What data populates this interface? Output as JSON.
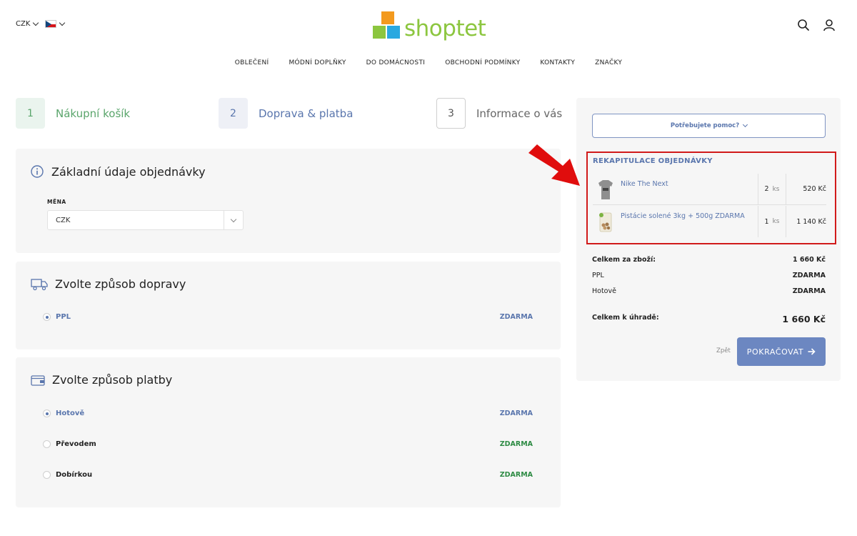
{
  "header": {
    "currency": "CZK",
    "logo_text": "shoptet",
    "nav": [
      "OBLEČENÍ",
      "MÓDNÍ DOPLŇKY",
      "DO DOMÁCNOSTI",
      "OBCHODNÍ PODMÍNKY",
      "KONTAKTY",
      "ZNAČKY"
    ],
    "icons": [
      "search-icon",
      "user-icon"
    ]
  },
  "steps": [
    {
      "num": "1",
      "label": "Nákupní košík"
    },
    {
      "num": "2",
      "label": "Doprava & platba"
    },
    {
      "num": "3",
      "label": "Informace o vás"
    }
  ],
  "order_basics": {
    "title": "Základní údaje objednávky",
    "currency_label": "MĚNA",
    "currency_value": "CZK"
  },
  "shipping": {
    "title": "Zvolte způsob dopravy",
    "options": [
      {
        "label": "PPL",
        "price": "ZDARMA",
        "selected": true
      }
    ]
  },
  "payment": {
    "title": "Zvolte způsob platby",
    "options": [
      {
        "label": "Hotově",
        "price": "ZDARMA",
        "selected": true
      },
      {
        "label": "Převodem",
        "price": "ZDARMA",
        "selected": false
      },
      {
        "label": "Dobírkou",
        "price": "ZDARMA",
        "selected": false
      }
    ]
  },
  "sidebar": {
    "help_label": "Potřebujete pomoc?",
    "recap_title": "REKAPITULACE OBJEDNÁVKY",
    "items": [
      {
        "name": "Nike The Next",
        "qty": "2",
        "unit": "ks",
        "price": "520 Kč"
      },
      {
        "name": "Pistácie solené 3kg + 500g ZDARMA",
        "qty": "1",
        "unit": "ks",
        "price": "1 140 Kč"
      }
    ],
    "totals": [
      {
        "label": "Celkem za zboží:",
        "value": "1 660 Kč"
      },
      {
        "label": "PPL",
        "value": "ZDARMA"
      },
      {
        "label": "Hotově",
        "value": "ZDARMA"
      }
    ],
    "grand_total_label": "Celkem k úhradě:",
    "grand_total_value": "1 660 Kč",
    "back_label": "Zpět",
    "continue_label": "POKRAČOVAT"
  },
  "colors": {
    "accent_blue": "#5a76ad",
    "button_blue": "#6c87c1",
    "green": "#5aa56b",
    "price_green": "#2e8b44",
    "highlight_red": "#d11a1a"
  }
}
